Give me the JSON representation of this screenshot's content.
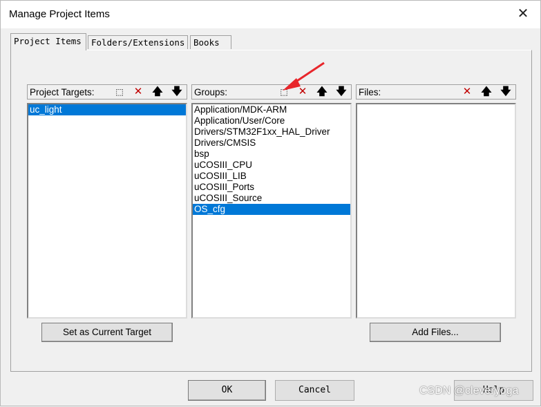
{
  "window": {
    "title": "Manage Project Items",
    "close_icon": "close-icon"
  },
  "tabs": [
    {
      "label": "Project Items",
      "active": true
    },
    {
      "label": "Folders/Extensions",
      "active": false
    },
    {
      "label": "Books",
      "active": false
    }
  ],
  "targets": {
    "label": "Project Targets:",
    "items": [
      {
        "text": "uc_light",
        "selected": true
      }
    ],
    "toolbar": [
      "new-icon",
      "delete-icon",
      "move-up-icon",
      "move-down-icon"
    ],
    "set_current_button": "Set as Current Target"
  },
  "groups": {
    "label": "Groups:",
    "items": [
      {
        "text": "Application/MDK-ARM",
        "selected": false
      },
      {
        "text": "Application/User/Core",
        "selected": false
      },
      {
        "text": "Drivers/STM32F1xx_HAL_Driver",
        "selected": false
      },
      {
        "text": "Drivers/CMSIS",
        "selected": false
      },
      {
        "text": "bsp",
        "selected": false
      },
      {
        "text": "uCOSIII_CPU",
        "selected": false
      },
      {
        "text": "uCOSIII_LIB",
        "selected": false
      },
      {
        "text": "uCOSIII_Ports",
        "selected": false
      },
      {
        "text": "uCOSIII_Source",
        "selected": false
      },
      {
        "text": "OS_cfg",
        "selected": true
      }
    ],
    "toolbar": [
      "new-icon",
      "delete-icon",
      "move-up-icon",
      "move-down-icon"
    ]
  },
  "files": {
    "label": "Files:",
    "items": [],
    "toolbar": [
      "delete-icon",
      "move-up-icon",
      "move-down-icon"
    ],
    "add_files_button": "Add Files..."
  },
  "footer": {
    "ok": "OK",
    "cancel": "Cancel",
    "help": "Help"
  },
  "watermark": "CSDN @cleveryoga",
  "colors": {
    "selection": "#0078d7",
    "annotation_arrow": "#e8262b",
    "delete": "#c00000"
  }
}
